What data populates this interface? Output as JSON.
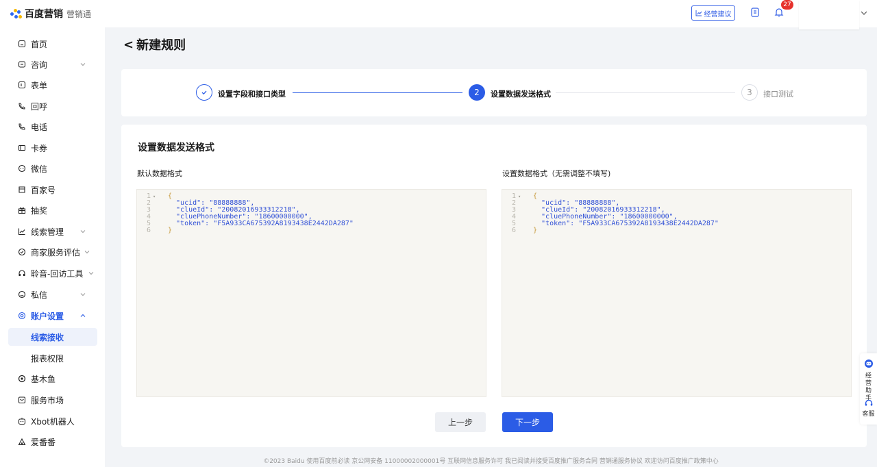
{
  "brand": {
    "name": "百度营销",
    "product": "营销通"
  },
  "topbar": {
    "advice_label": "经营建议",
    "notification_count": "27"
  },
  "sidebar": {
    "items": [
      {
        "label": "首页",
        "icon": "home-icon",
        "chevron": false
      },
      {
        "label": "咨询",
        "icon": "chat-icon",
        "chevron": true
      },
      {
        "label": "表单",
        "icon": "form-icon",
        "chevron": false
      },
      {
        "label": "回呼",
        "icon": "callback-icon",
        "chevron": false
      },
      {
        "label": "电话",
        "icon": "phone-icon",
        "chevron": false
      },
      {
        "label": "卡券",
        "icon": "coupon-icon",
        "chevron": false
      },
      {
        "label": "微信",
        "icon": "wechat-icon",
        "chevron": false
      },
      {
        "label": "百家号",
        "icon": "baijiahao-icon",
        "chevron": false
      },
      {
        "label": "抽奖",
        "icon": "gift-icon",
        "chevron": false
      },
      {
        "label": "线索管理",
        "icon": "chart-icon",
        "chevron": true
      },
      {
        "label": "商家服务评估",
        "icon": "shield-icon",
        "chevron": true
      },
      {
        "label": "聆音-回访工具",
        "icon": "headset-icon",
        "chevron": true
      },
      {
        "label": "私信",
        "icon": "message-icon",
        "chevron": true
      },
      {
        "label": "账户设置",
        "icon": "settings-icon",
        "chevron": true,
        "active": true
      },
      {
        "label": "线索接收",
        "sub": true,
        "selected": true
      },
      {
        "label": "报表权限",
        "sub": true
      },
      {
        "label": "基木鱼",
        "icon": "fish-icon",
        "chevron": false
      },
      {
        "label": "服务市场",
        "icon": "market-icon",
        "chevron": false
      },
      {
        "label": "Xbot机器人",
        "icon": "robot-icon",
        "chevron": false
      },
      {
        "label": "爱番番",
        "icon": "aifanfan-icon",
        "chevron": false
      }
    ]
  },
  "page": {
    "back_symbol": "<",
    "title": "新建规则"
  },
  "steps": [
    {
      "number": "1",
      "label": "设置字段和接口类型",
      "state": "done"
    },
    {
      "number": "2",
      "label": "设置数据发送格式",
      "state": "current"
    },
    {
      "number": "3",
      "label": "接口测试",
      "state": "pending"
    }
  ],
  "content": {
    "section_title": "设置数据发送格式",
    "left_label": "默认数据格式",
    "right_label": "设置数据格式（无需调整不填写)",
    "code_lines": [
      {
        "n": "1",
        "text": "{",
        "fold": true
      },
      {
        "n": "2",
        "text": "  \"ucid\": \"88888888\","
      },
      {
        "n": "3",
        "text": "  \"clueId\": \"20082016933312218\","
      },
      {
        "n": "4",
        "text": "  \"cluePhoneNumber\": \"18600000000\","
      },
      {
        "n": "5",
        "text": "  \"token\": \"F5A933CA675392A8193438E2442DA287\""
      },
      {
        "n": "6",
        "text": "}"
      }
    ],
    "prev_label": "上一步",
    "next_label": "下一步"
  },
  "footer": "©2023  Baidu 使用百度前必读 京公网安备 11000002000001号 互联网信息服务许可 我已阅读并接受百度推广服务合同 营销通服务协议 欢迎访问百度推广政策中心",
  "float_panel": {
    "assistant_label": "经营助手",
    "service_label": "客服"
  },
  "colors": {
    "primary": "#2b5ce6",
    "badge": "#e6322d",
    "code_key": "#2f4fd6"
  }
}
